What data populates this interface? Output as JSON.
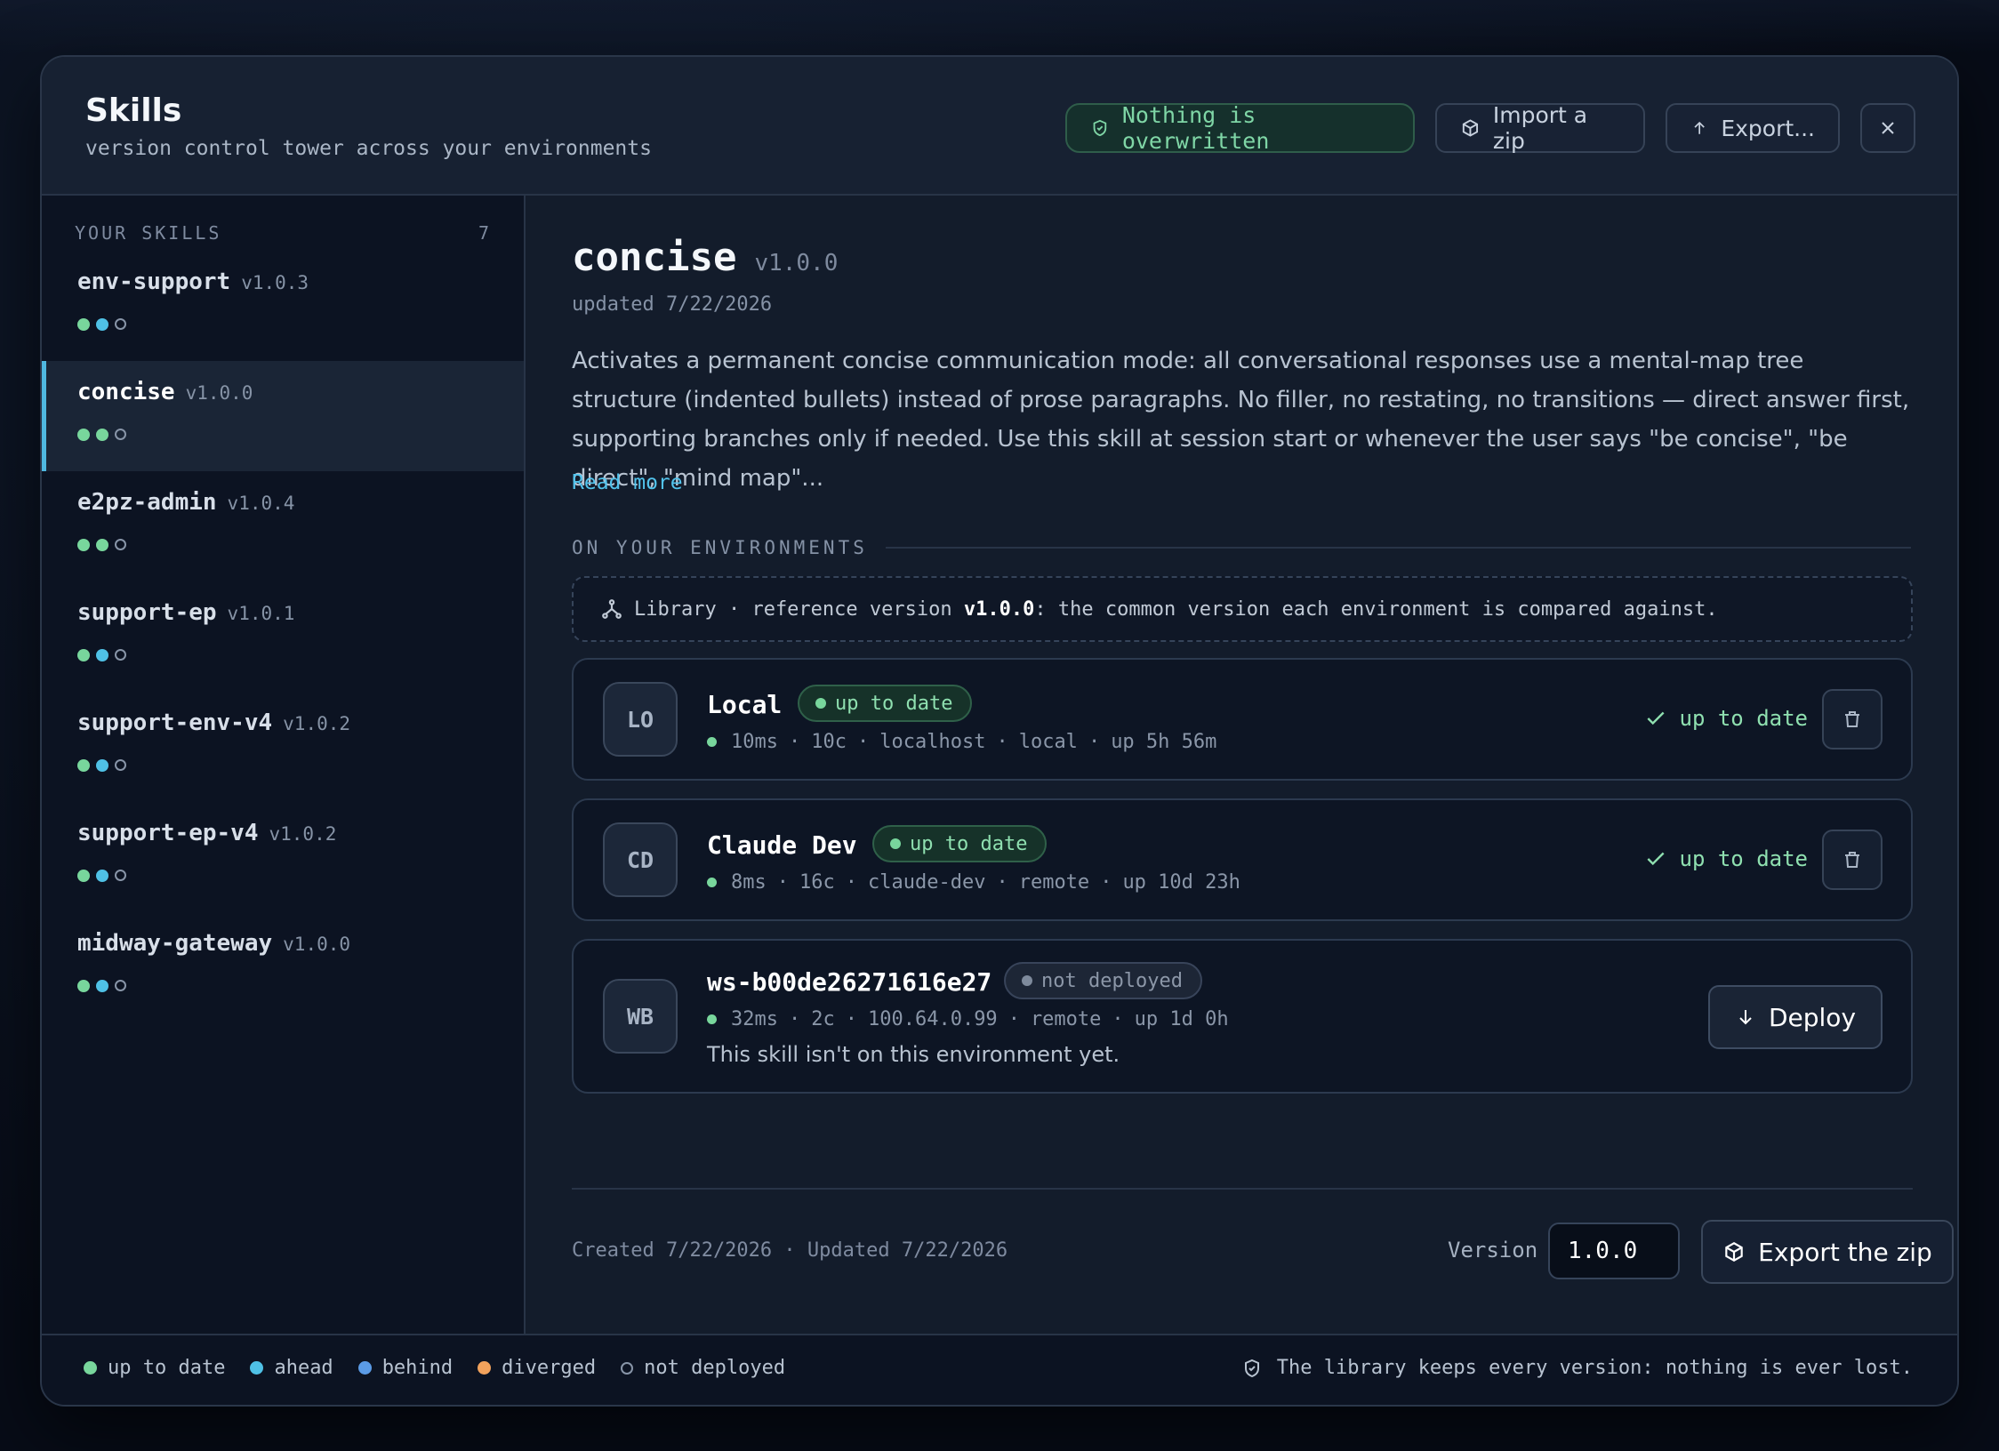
{
  "header": {
    "title": "Skills",
    "subtitle": "version control tower across your environments",
    "safe_badge": "Nothing is overwritten",
    "import_label": "Import a zip",
    "export_label": "Export..."
  },
  "sidebar": {
    "heading": "YOUR SKILLS",
    "count": "7",
    "items": [
      {
        "name": "env-support",
        "version": "v1.0.3",
        "dots": [
          "green",
          "cyan",
          "empty"
        ]
      },
      {
        "name": "concise",
        "version": "v1.0.0",
        "dots": [
          "green",
          "green",
          "empty"
        ],
        "selected": true
      },
      {
        "name": "e2pz-admin",
        "version": "v1.0.4",
        "dots": [
          "green",
          "green",
          "empty"
        ]
      },
      {
        "name": "support-ep",
        "version": "v1.0.1",
        "dots": [
          "green",
          "cyan",
          "empty"
        ]
      },
      {
        "name": "support-env-v4",
        "version": "v1.0.2",
        "dots": [
          "green",
          "cyan",
          "empty"
        ]
      },
      {
        "name": "support-ep-v4",
        "version": "v1.0.2",
        "dots": [
          "green",
          "cyan",
          "empty"
        ]
      },
      {
        "name": "midway-gateway",
        "version": "v1.0.0",
        "dots": [
          "green",
          "cyan",
          "empty"
        ]
      }
    ]
  },
  "detail": {
    "name": "concise",
    "version": "v1.0.0",
    "updated": "updated 7/22/2026",
    "description": "Activates a permanent concise communication mode: all conversational responses use a mental-map tree structure (indented bullets) instead of prose paragraphs. No filler, no restating, no transitions — direct answer first, supporting branches only if needed. Use this skill at session start or whenever the user says \"be concise\", \"be direct\", \"mind map\"...",
    "read_more": "Read more",
    "section_label": "ON YOUR ENVIRONMENTS",
    "library": {
      "prefix": "Library · reference version ",
      "version": "v1.0.0",
      "suffix": ": the common version each environment is compared against."
    },
    "environments": [
      {
        "initials": "LO",
        "name": "Local",
        "pill": "up to date",
        "pill_kind": "green",
        "meta": [
          "10ms",
          "10c",
          "localhost",
          "local",
          "up 5h 56m"
        ],
        "status": "up to date"
      },
      {
        "initials": "CD",
        "name": "Claude Dev",
        "pill": "up to date",
        "pill_kind": "green",
        "meta": [
          "8ms",
          "16c",
          "claude-dev",
          "remote",
          "up 10d 23h"
        ],
        "status": "up to date"
      },
      {
        "initials": "WB",
        "name": "ws-b00de26271616e27",
        "pill": "not deployed",
        "pill_kind": "gray",
        "meta": [
          "32ms",
          "2c",
          "100.64.0.99",
          "remote",
          "up 1d 0h"
        ],
        "message": "This skill isn't on this environment yet.",
        "action": "Deploy"
      }
    ],
    "footer": {
      "created": "Created 7/22/2026 · Updated 7/22/2026",
      "version_label": "Version",
      "version_value": "1.0.0",
      "export_label": "Export the zip"
    }
  },
  "legend": [
    {
      "label": "up to date",
      "color": "#78d69c"
    },
    {
      "label": "ahead",
      "color": "#4fc1e6"
    },
    {
      "label": "behind",
      "color": "#5b9be6"
    },
    {
      "label": "diverged",
      "color": "#f2a25c"
    },
    {
      "label": "not deployed",
      "color": "hollow"
    }
  ],
  "footer_note": "The library keeps every version: nothing is ever lost."
}
